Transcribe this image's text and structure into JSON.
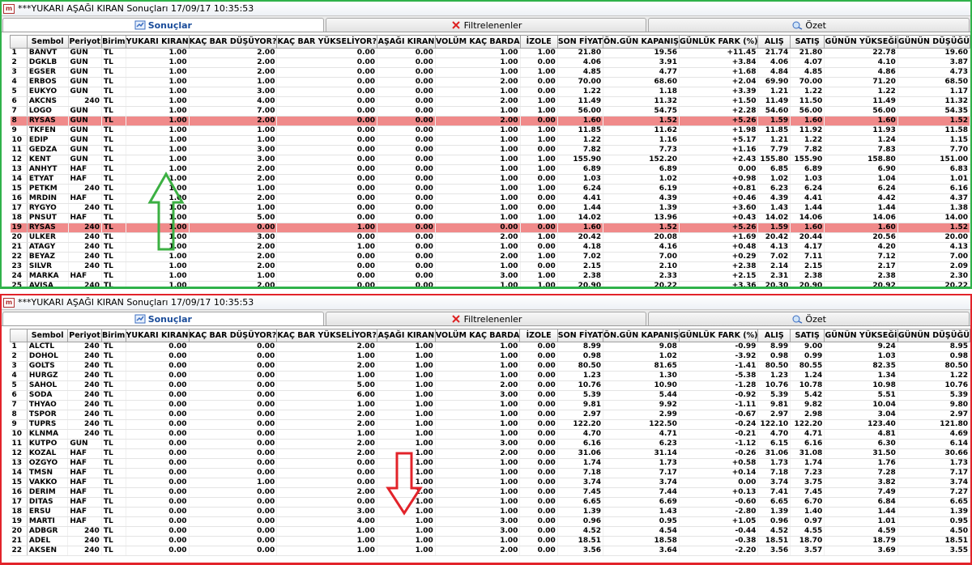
{
  "top": {
    "title": "***YUKARI AŞAĞI KIRAN Sonuçları  17/09/17 10:35:53",
    "tabs": [
      {
        "label": "Sonuçlar",
        "icon": "results-icon",
        "active": true
      },
      {
        "label": "Filtrelenenler",
        "icon": "filter-x-icon",
        "active": false
      },
      {
        "label": "Özet",
        "icon": "summary-icon",
        "active": false
      }
    ],
    "headers": [
      "Sembol",
      "Periyot",
      "Birim",
      "YUKARI KIRAN",
      "KAÇ BAR DÜŞÜYOR?",
      "KAÇ BAR YÜKSELİYOR?",
      "AŞAĞI KIRAN",
      "VOLÜM KAÇ BARDA",
      "İZOLE",
      "SON FİYAT",
      "ÖN.GÜN KAPANIŞ",
      "GÜNLÜK FARK (%)",
      "ALIŞ",
      "SATIŞ",
      "GÜNÜN YÜKSEĞİ",
      "GÜNÜN DÜŞÜĞÜ"
    ],
    "highlight_rows": [
      8,
      19
    ],
    "rows": [
      [
        "1",
        "BANVT",
        "GUN",
        "TL",
        "1.00",
        "2.00",
        "0.00",
        "0.00",
        "1.00",
        "1.00",
        "21.80",
        "19.56",
        "+11.45",
        "21.74",
        "21.80",
        "22.78",
        "19.60"
      ],
      [
        "2",
        "DGKLB",
        "GUN",
        "TL",
        "1.00",
        "2.00",
        "0.00",
        "0.00",
        "1.00",
        "0.00",
        "4.06",
        "3.91",
        "+3.84",
        "4.06",
        "4.07",
        "4.10",
        "3.87"
      ],
      [
        "3",
        "EGSER",
        "GUN",
        "TL",
        "1.00",
        "2.00",
        "0.00",
        "0.00",
        "1.00",
        "1.00",
        "4.85",
        "4.77",
        "+1.68",
        "4.84",
        "4.85",
        "4.86",
        "4.73"
      ],
      [
        "4",
        "ERBOS",
        "GUN",
        "TL",
        "1.00",
        "1.00",
        "0.00",
        "0.00",
        "2.00",
        "0.00",
        "70.00",
        "68.60",
        "+2.04",
        "69.90",
        "70.00",
        "71.20",
        "68.50"
      ],
      [
        "5",
        "EUKYO",
        "GUN",
        "TL",
        "1.00",
        "3.00",
        "0.00",
        "0.00",
        "1.00",
        "0.00",
        "1.22",
        "1.18",
        "+3.39",
        "1.21",
        "1.22",
        "1.22",
        "1.17"
      ],
      [
        "6",
        "AKCNS",
        "240",
        "TL",
        "1.00",
        "4.00",
        "0.00",
        "0.00",
        "2.00",
        "1.00",
        "11.49",
        "11.32",
        "+1.50",
        "11.49",
        "11.50",
        "11.49",
        "11.32"
      ],
      [
        "7",
        "LOGO",
        "GUN",
        "TL",
        "1.00",
        "7.00",
        "0.00",
        "0.00",
        "1.00",
        "1.00",
        "56.00",
        "54.75",
        "+2.28",
        "54.60",
        "56.00",
        "56.00",
        "54.35"
      ],
      [
        "8",
        "RYSAS",
        "GUN",
        "TL",
        "1.00",
        "2.00",
        "0.00",
        "0.00",
        "2.00",
        "0.00",
        "1.60",
        "1.52",
        "+5.26",
        "1.59",
        "1.60",
        "1.60",
        "1.52"
      ],
      [
        "9",
        "TKFEN",
        "GUN",
        "TL",
        "1.00",
        "1.00",
        "0.00",
        "0.00",
        "1.00",
        "1.00",
        "11.85",
        "11.62",
        "+1.98",
        "11.85",
        "11.92",
        "11.93",
        "11.58"
      ],
      [
        "10",
        "EDIP",
        "GUN",
        "TL",
        "1.00",
        "1.00",
        "0.00",
        "0.00",
        "1.00",
        "1.00",
        "1.22",
        "1.16",
        "+5.17",
        "1.21",
        "1.22",
        "1.24",
        "1.15"
      ],
      [
        "11",
        "GEDZA",
        "GUN",
        "TL",
        "1.00",
        "3.00",
        "0.00",
        "0.00",
        "1.00",
        "0.00",
        "7.82",
        "7.73",
        "+1.16",
        "7.79",
        "7.82",
        "7.83",
        "7.70"
      ],
      [
        "12",
        "KENT",
        "GUN",
        "TL",
        "1.00",
        "3.00",
        "0.00",
        "0.00",
        "1.00",
        "1.00",
        "155.90",
        "152.20",
        "+2.43",
        "155.80",
        "155.90",
        "158.80",
        "151.00"
      ],
      [
        "13",
        "ANHYT",
        "HAF",
        "TL",
        "1.00",
        "2.00",
        "0.00",
        "0.00",
        "1.00",
        "1.00",
        "6.89",
        "6.89",
        "0.00",
        "6.85",
        "6.89",
        "6.90",
        "6.83"
      ],
      [
        "14",
        "ETYAT",
        "HAF",
        "TL",
        "1.00",
        "2.00",
        "0.00",
        "0.00",
        "1.00",
        "0.00",
        "1.03",
        "1.02",
        "+0.98",
        "1.02",
        "1.03",
        "1.04",
        "1.01"
      ],
      [
        "15",
        "PETKM",
        "240",
        "TL",
        "1.00",
        "1.00",
        "0.00",
        "0.00",
        "1.00",
        "1.00",
        "6.24",
        "6.19",
        "+0.81",
        "6.23",
        "6.24",
        "6.24",
        "6.16"
      ],
      [
        "16",
        "MRDIN",
        "HAF",
        "TL",
        "1.00",
        "2.00",
        "0.00",
        "0.00",
        "1.00",
        "0.00",
        "4.41",
        "4.39",
        "+0.46",
        "4.39",
        "4.41",
        "4.42",
        "4.37"
      ],
      [
        "17",
        "RYGYO",
        "240",
        "TL",
        "1.00",
        "1.00",
        "0.00",
        "0.00",
        "1.00",
        "0.00",
        "1.44",
        "1.39",
        "+3.60",
        "1.43",
        "1.44",
        "1.44",
        "1.38"
      ],
      [
        "18",
        "PNSUT",
        "HAF",
        "TL",
        "1.00",
        "5.00",
        "0.00",
        "0.00",
        "1.00",
        "1.00",
        "14.02",
        "13.96",
        "+0.43",
        "14.02",
        "14.06",
        "14.06",
        "14.00"
      ],
      [
        "19",
        "RYSAS",
        "240",
        "TL",
        "1.00",
        "0.00",
        "1.00",
        "0.00",
        "0.00",
        "0.00",
        "1.60",
        "1.52",
        "+5.26",
        "1.59",
        "1.60",
        "1.60",
        "1.52"
      ],
      [
        "20",
        "ULKER",
        "240",
        "TL",
        "1.00",
        "3.00",
        "0.00",
        "0.00",
        "2.00",
        "1.00",
        "20.42",
        "20.08",
        "+1.69",
        "20.42",
        "20.44",
        "20.56",
        "20.00"
      ],
      [
        "21",
        "ATAGY",
        "240",
        "TL",
        "1.00",
        "2.00",
        "1.00",
        "0.00",
        "1.00",
        "0.00",
        "4.18",
        "4.16",
        "+0.48",
        "4.13",
        "4.17",
        "4.20",
        "4.13"
      ],
      [
        "22",
        "BEYAZ",
        "240",
        "TL",
        "1.00",
        "2.00",
        "0.00",
        "0.00",
        "2.00",
        "1.00",
        "7.02",
        "7.00",
        "+0.29",
        "7.02",
        "7.11",
        "7.12",
        "7.00"
      ],
      [
        "23",
        "SILVR",
        "240",
        "TL",
        "1.00",
        "2.00",
        "0.00",
        "0.00",
        "1.00",
        "0.00",
        "2.15",
        "2.10",
        "+2.38",
        "2.14",
        "2.15",
        "2.17",
        "2.09"
      ],
      [
        "24",
        "MARKA",
        "HAF",
        "TL",
        "1.00",
        "1.00",
        "0.00",
        "0.00",
        "3.00",
        "1.00",
        "2.38",
        "2.33",
        "+2.15",
        "2.31",
        "2.38",
        "2.38",
        "2.30"
      ],
      [
        "25",
        "AVISA",
        "240",
        "TL",
        "1.00",
        "2.00",
        "0.00",
        "0.00",
        "1.00",
        "1.00",
        "20.90",
        "20.22",
        "+3.36",
        "20.30",
        "20.90",
        "20.92",
        "20.22"
      ]
    ]
  },
  "bottom": {
    "title": "***YUKARI AŞAĞI KIRAN Sonuçları  17/09/17 10:35:53",
    "tabs": [
      {
        "label": "Sonuçlar",
        "icon": "results-icon",
        "active": true
      },
      {
        "label": "Filtrelenenler",
        "icon": "filter-x-icon",
        "active": false
      },
      {
        "label": "Özet",
        "icon": "summary-icon",
        "active": false
      }
    ],
    "headers": [
      "Sembol",
      "Periyot",
      "Birim",
      "YUKARI KIRAN",
      "KAÇ BAR DÜŞÜYOR?",
      "KAÇ BAR YÜKSELİYOR?",
      "AŞAĞI KIRAN",
      "VOLÜM KAÇ BARDA",
      "İZOLE",
      "SON FİYAT",
      "ÖN.GÜN KAPANIŞ",
      "GÜNLÜK FARK (%)",
      "ALIŞ",
      "SATIŞ",
      "GÜNÜN YÜKSEĞİ",
      "GÜNÜN DÜŞÜĞÜ"
    ],
    "highlight_rows": [],
    "rows": [
      [
        "1",
        "ALCTL",
        "240",
        "TL",
        "0.00",
        "0.00",
        "2.00",
        "1.00",
        "1.00",
        "0.00",
        "8.99",
        "9.08",
        "-0.99",
        "8.99",
        "9.00",
        "9.24",
        "8.95"
      ],
      [
        "2",
        "DOHOL",
        "240",
        "TL",
        "0.00",
        "0.00",
        "1.00",
        "1.00",
        "1.00",
        "0.00",
        "0.98",
        "1.02",
        "-3.92",
        "0.98",
        "0.99",
        "1.03",
        "0.98"
      ],
      [
        "3",
        "GOLTS",
        "240",
        "TL",
        "0.00",
        "0.00",
        "2.00",
        "1.00",
        "1.00",
        "0.00",
        "80.50",
        "81.65",
        "-1.41",
        "80.50",
        "80.55",
        "82.35",
        "80.50"
      ],
      [
        "4",
        "HURGZ",
        "240",
        "TL",
        "0.00",
        "0.00",
        "1.00",
        "1.00",
        "1.00",
        "0.00",
        "1.23",
        "1.30",
        "-5.38",
        "1.23",
        "1.24",
        "1.34",
        "1.22"
      ],
      [
        "5",
        "SAHOL",
        "240",
        "TL",
        "0.00",
        "0.00",
        "5.00",
        "1.00",
        "2.00",
        "0.00",
        "10.76",
        "10.90",
        "-1.28",
        "10.76",
        "10.78",
        "10.98",
        "10.76"
      ],
      [
        "6",
        "SODA",
        "240",
        "TL",
        "0.00",
        "0.00",
        "6.00",
        "1.00",
        "3.00",
        "0.00",
        "5.39",
        "5.44",
        "-0.92",
        "5.39",
        "5.42",
        "5.51",
        "5.39"
      ],
      [
        "7",
        "THYAO",
        "240",
        "TL",
        "0.00",
        "0.00",
        "1.00",
        "1.00",
        "1.00",
        "0.00",
        "9.81",
        "9.92",
        "-1.11",
        "9.81",
        "9.82",
        "10.04",
        "9.80"
      ],
      [
        "8",
        "TSPOR",
        "240",
        "TL",
        "0.00",
        "0.00",
        "2.00",
        "1.00",
        "1.00",
        "0.00",
        "2.97",
        "2.99",
        "-0.67",
        "2.97",
        "2.98",
        "3.04",
        "2.97"
      ],
      [
        "9",
        "TUPRS",
        "240",
        "TL",
        "0.00",
        "0.00",
        "2.00",
        "1.00",
        "1.00",
        "0.00",
        "122.20",
        "122.50",
        "-0.24",
        "122.10",
        "122.20",
        "123.40",
        "121.80"
      ],
      [
        "10",
        "KLNMA",
        "240",
        "TL",
        "0.00",
        "0.00",
        "1.00",
        "1.00",
        "1.00",
        "0.00",
        "4.70",
        "4.71",
        "-0.21",
        "4.70",
        "4.71",
        "4.81",
        "4.69"
      ],
      [
        "11",
        "KUTPO",
        "GUN",
        "TL",
        "0.00",
        "0.00",
        "2.00",
        "1.00",
        "3.00",
        "0.00",
        "6.16",
        "6.23",
        "-1.12",
        "6.15",
        "6.16",
        "6.30",
        "6.14"
      ],
      [
        "12",
        "KOZAL",
        "HAF",
        "TL",
        "0.00",
        "0.00",
        "2.00",
        "1.00",
        "2.00",
        "0.00",
        "31.06",
        "31.14",
        "-0.26",
        "31.06",
        "31.08",
        "31.50",
        "30.66"
      ],
      [
        "13",
        "OZGYO",
        "HAF",
        "TL",
        "0.00",
        "0.00",
        "0.00",
        "1.00",
        "1.00",
        "0.00",
        "1.74",
        "1.73",
        "+0.58",
        "1.73",
        "1.74",
        "1.76",
        "1.73"
      ],
      [
        "14",
        "TMSN",
        "HAF",
        "TL",
        "0.00",
        "0.00",
        "0.00",
        "1.00",
        "1.00",
        "0.00",
        "7.18",
        "7.17",
        "+0.14",
        "7.18",
        "7.23",
        "7.28",
        "7.17"
      ],
      [
        "15",
        "VAKKO",
        "HAF",
        "TL",
        "0.00",
        "1.00",
        "0.00",
        "1.00",
        "1.00",
        "0.00",
        "3.74",
        "3.74",
        "0.00",
        "3.74",
        "3.75",
        "3.82",
        "3.74"
      ],
      [
        "16",
        "DERIM",
        "HAF",
        "TL",
        "0.00",
        "0.00",
        "2.00",
        "1.00",
        "1.00",
        "0.00",
        "7.45",
        "7.44",
        "+0.13",
        "7.41",
        "7.45",
        "7.49",
        "7.27"
      ],
      [
        "17",
        "DITAS",
        "HAF",
        "TL",
        "0.00",
        "0.00",
        "0.00",
        "1.00",
        "1.00",
        "0.00",
        "6.65",
        "6.69",
        "-0.60",
        "6.65",
        "6.70",
        "6.84",
        "6.65"
      ],
      [
        "18",
        "ERSU",
        "HAF",
        "TL",
        "0.00",
        "0.00",
        "3.00",
        "1.00",
        "1.00",
        "0.00",
        "1.39",
        "1.43",
        "-2.80",
        "1.39",
        "1.40",
        "1.44",
        "1.39"
      ],
      [
        "19",
        "MARTI",
        "HAF",
        "TL",
        "0.00",
        "0.00",
        "4.00",
        "1.00",
        "3.00",
        "0.00",
        "0.96",
        "0.95",
        "+1.05",
        "0.96",
        "0.97",
        "1.01",
        "0.95"
      ],
      [
        "20",
        "ADBGR",
        "240",
        "TL",
        "0.00",
        "0.00",
        "1.00",
        "1.00",
        "3.00",
        "0.00",
        "4.52",
        "4.54",
        "-0.44",
        "4.52",
        "4.55",
        "4.59",
        "4.50"
      ],
      [
        "21",
        "ADEL",
        "240",
        "TL",
        "0.00",
        "0.00",
        "1.00",
        "1.00",
        "1.00",
        "0.00",
        "18.51",
        "18.58",
        "-0.38",
        "18.51",
        "18.70",
        "18.79",
        "18.51"
      ],
      [
        "22",
        "AKSEN",
        "240",
        "TL",
        "0.00",
        "0.00",
        "1.00",
        "1.00",
        "2.00",
        "0.00",
        "3.56",
        "3.64",
        "-2.20",
        "3.56",
        "3.57",
        "3.69",
        "3.55"
      ]
    ]
  },
  "colors": {
    "top_border": "#2fb24a",
    "bottom_border": "#e2232a",
    "highlight_row": "#f08a8a",
    "up_arrow": "#3cb043",
    "down_arrow": "#e2232a",
    "active_tab_text": "#1a4c9a"
  },
  "annotations": {
    "top_arrow": "arrow-up-icon",
    "bottom_arrow": "arrow-down-icon"
  }
}
